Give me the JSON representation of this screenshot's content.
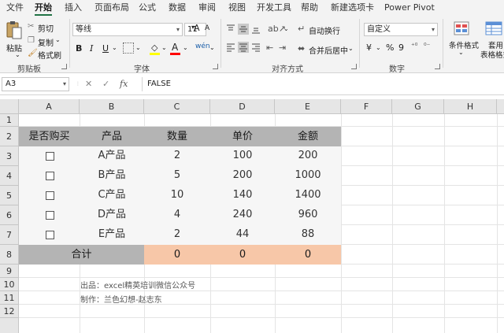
{
  "ribbon_tabs": [
    "文件",
    "开始",
    "插入",
    "页面布局",
    "公式",
    "数据",
    "审阅",
    "视图",
    "开发工具",
    "帮助",
    "新建选项卡",
    "Power Pivot"
  ],
  "active_tab": "开始",
  "clipboard": {
    "paste": "粘贴",
    "cut": "剪切",
    "copy": "复制",
    "format_painter": "格式刷",
    "group": "剪贴板"
  },
  "font": {
    "name": "等线",
    "size": "11",
    "bold": "B",
    "italic": "I",
    "underline": "U",
    "grow": "A",
    "shrink": "A",
    "font_color_letter": "A",
    "font_color": "#ff0000",
    "fill_color": "#ffff00",
    "phonetic": "wén",
    "group": "字体"
  },
  "alignment": {
    "wrap_text": "自动换行",
    "merge_center": "合并后居中",
    "group": "对齐方式"
  },
  "number": {
    "format": "自定义",
    "currency": "¥",
    "percent": "%",
    "comma": "9",
    "group": "数字"
  },
  "styles": {
    "conditional_format": "条件格式",
    "table_format_line1": "套用",
    "table_format_line2": "表格格式"
  },
  "formula_bar": {
    "name_box": "A3",
    "cancel": "✕",
    "enter": "✓",
    "fx": "fx",
    "formula": "FALSE"
  },
  "columns": [
    "A",
    "B",
    "C",
    "D",
    "E",
    "F",
    "G",
    "H"
  ],
  "rows": [
    "1",
    "2",
    "3",
    "4",
    "5",
    "6",
    "7",
    "8",
    "9",
    "10",
    "11",
    "12"
  ],
  "table": {
    "headers": [
      "是否购买",
      "产品",
      "数量",
      "单价",
      "金额"
    ],
    "rows": [
      {
        "checked": false,
        "product": "A产品",
        "qty": "2",
        "price": "100",
        "amount": "200"
      },
      {
        "checked": false,
        "product": "B产品",
        "qty": "5",
        "price": "200",
        "amount": "1000"
      },
      {
        "checked": false,
        "product": "C产品",
        "qty": "10",
        "price": "140",
        "amount": "1400"
      },
      {
        "checked": false,
        "product": "D产品",
        "qty": "4",
        "price": "240",
        "amount": "960"
      },
      {
        "checked": false,
        "product": "E产品",
        "qty": "2",
        "price": "44",
        "amount": "88"
      }
    ],
    "total_label": "合计",
    "totals": [
      "0",
      "0",
      "0"
    ]
  },
  "notes": {
    "source": "出品：excel精英培训微信公众号",
    "author": "制作：兰色幻想-赵志东"
  },
  "colors": {
    "accent": "#217346",
    "header_fill": "#b4b4b4",
    "total_fill": "#f7c7a8"
  }
}
